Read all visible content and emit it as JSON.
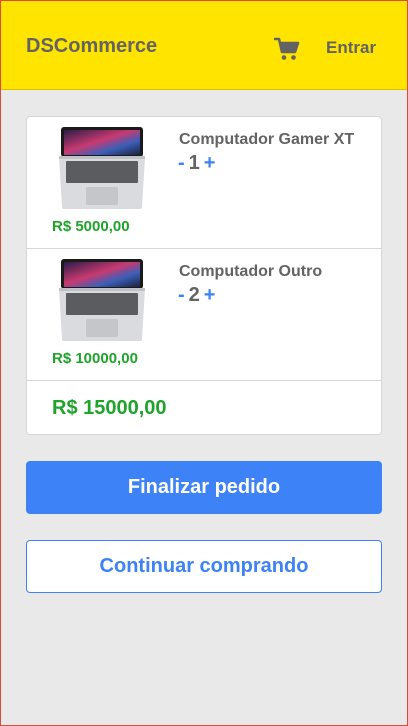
{
  "header": {
    "brand": "DSCommerce",
    "cart_icon": "shopping-cart-icon",
    "login_label": "Entrar"
  },
  "cart": {
    "items": [
      {
        "name": "Computador Gamer XT",
        "quantity": "1",
        "price": "R$ 5000,00",
        "image": "laptop-image"
      },
      {
        "name": "Computador Outro",
        "quantity": "2",
        "price": "R$ 10000,00",
        "image": "laptop-image"
      }
    ],
    "decrement_label": "-",
    "increment_label": "+",
    "total": "R$ 15000,00"
  },
  "actions": {
    "checkout_label": "Finalizar pedido",
    "continue_label": "Continuar comprando"
  },
  "colors": {
    "header_bg": "#ffe400",
    "accent_blue": "#3d82f6",
    "price_green": "#1fa32a",
    "text_gray": "#636363"
  }
}
